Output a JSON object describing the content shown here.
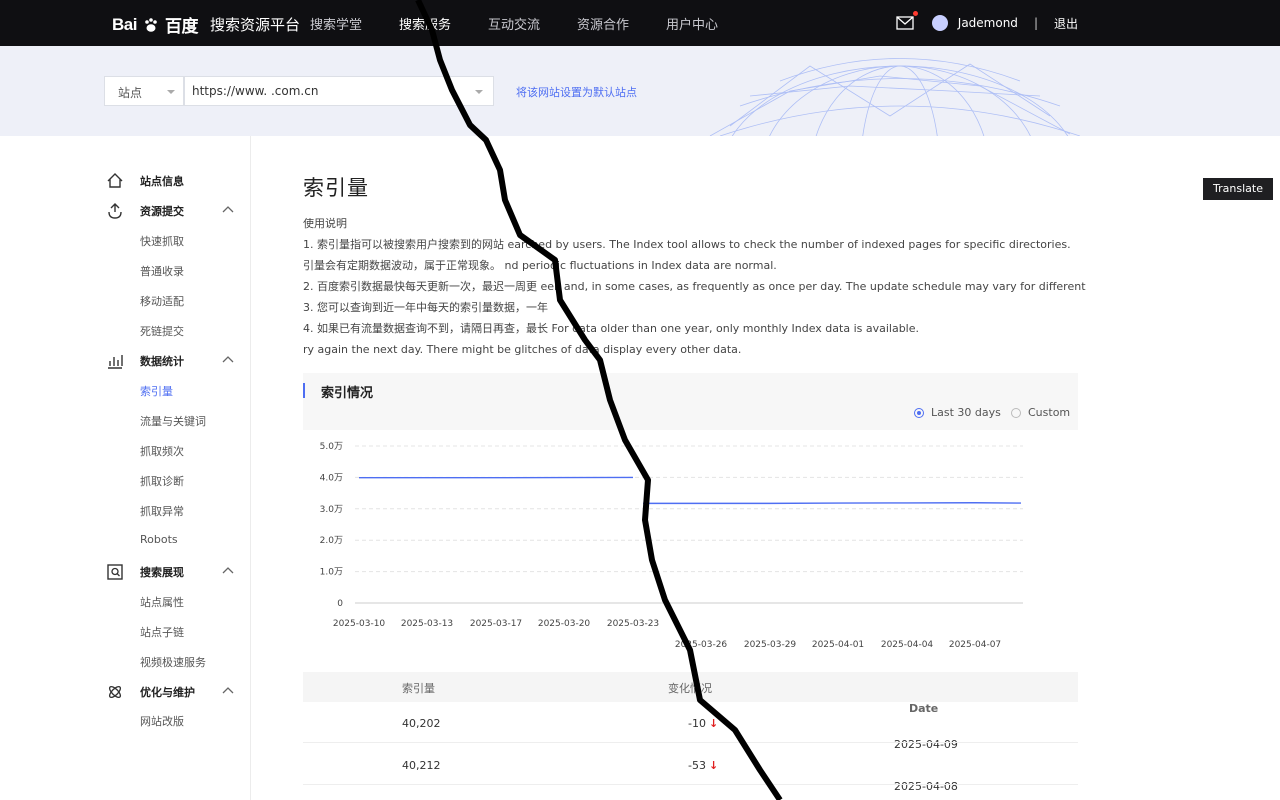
{
  "header": {
    "logo_text": "Bai",
    "logo_cn": "百度",
    "platform": "搜索资源平台",
    "nav": [
      "搜索学堂",
      "搜索服务",
      "互动交流",
      "资源合作",
      "用户中心"
    ],
    "nav_active_index": 1,
    "username": "Jademond",
    "logout": "退出"
  },
  "site_bar": {
    "type_label": "站点",
    "url": "https://www.            .com.cn",
    "set_default": "将该网站设置为默认站点"
  },
  "translate_button": "Translate",
  "sidebar": {
    "groups": [
      {
        "label": "站点信息",
        "icon": "home-icon",
        "items": []
      },
      {
        "label": "资源提交",
        "icon": "submit-icon",
        "items": [
          "快速抓取",
          "普通收录",
          "移动适配",
          "死链提交"
        ]
      },
      {
        "label": "数据统计",
        "icon": "stats-icon",
        "items": [
          "索引量",
          "流量与关键词",
          "抓取频次",
          "抓取诊断",
          "抓取异常",
          "Robots"
        ]
      },
      {
        "label": "搜索展现",
        "icon": "search-display-icon",
        "items": [
          "站点属性",
          "站点子链",
          "视频极速服务"
        ]
      },
      {
        "label": "优化与维护",
        "icon": "optimize-icon",
        "items": [
          "网站改版"
        ]
      }
    ],
    "active_item": "索引量"
  },
  "page": {
    "title": "索引量",
    "usage_title": "使用说明",
    "usage_lines": [
      "1. 索引量指可以被搜索用户搜索到的网站                  earched by users. The Index tool allows to check the number of indexed pages for specific directories.",
      "引量会有定期数据波动，属于正常现象。             nd periodic fluctuations in Index data are normal.",
      "2. 百度索引数据最快每天更新一次，最迟一周更      eek and, in some cases, as frequently as once per day. The update schedule may vary for different",
      "3. 您可以查询到近一年中每天的索引量数据，一年",
      "4. 如果已有流量数据查询不到，请隔日再查，最长      For data older than one year, only monthly Index data is available.",
      "                                                      ry again the next day. There might be glitches of data display every other data."
    ],
    "section_title": "索引情况",
    "range_options": [
      "Last 30 days",
      "Custom"
    ],
    "range_selected": "Last 30 days"
  },
  "chart_data": {
    "type": "line",
    "y_ticks": [
      "5.0万",
      "4.0万",
      "3.0万",
      "2.0万",
      "1.0万",
      "0"
    ],
    "ylim": [
      0,
      50000
    ],
    "x_ticks_left": [
      "2025-03-10",
      "2025-03-13",
      "2025-03-17",
      "2025-03-20",
      "2025-03-23"
    ],
    "x_ticks_right": [
      "2025-03-26",
      "2025-03-29",
      "2025-04-01",
      "2025-04-04",
      "2025-04-07"
    ],
    "series": [
      {
        "color": "#4e6ef2",
        "x_left": [
          "2025-03-10",
          "2025-03-13",
          "2025-03-17",
          "2025-03-20",
          "2025-03-23"
        ],
        "values_left": [
          39900,
          39900,
          39900,
          39950,
          40000
        ],
        "x_right": [
          "2025-03-23",
          "2025-03-26",
          "2025-03-29",
          "2025-04-01",
          "2025-04-04",
          "2025-04-07",
          "2025-04-09"
        ],
        "values_right": [
          33000,
          33000,
          33000,
          33100,
          33150,
          33200,
          33100
        ]
      }
    ],
    "grid": true
  },
  "table": {
    "headers": [
      "索引量",
      "变化情况",
      "Date"
    ],
    "rows": [
      {
        "index": "40,202",
        "change": "-10",
        "date": "2025-04-09"
      },
      {
        "index": "40,212",
        "change": "-53",
        "date": "2025-04-08"
      }
    ]
  },
  "colors": {
    "accent": "#4e6ef2",
    "topbar": "#0f0f12",
    "band": "#eef0f8",
    "down_arrow": "#e02020"
  }
}
